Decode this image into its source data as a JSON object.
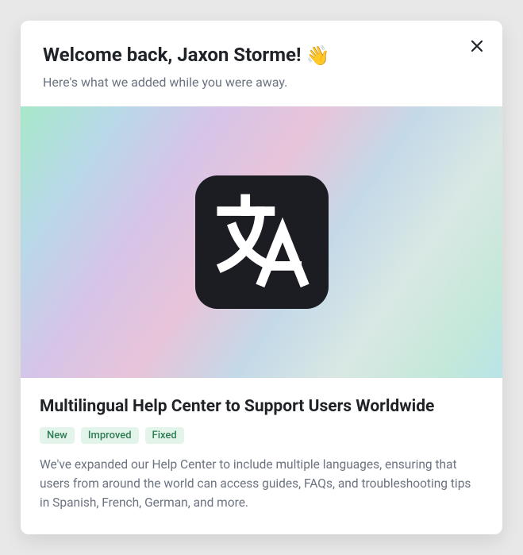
{
  "header": {
    "title": "Welcome back, Jaxon Storme!",
    "wave_emoji": "👋",
    "subtitle": "Here's what we added while you were away."
  },
  "hero": {
    "icon_name": "translate-icon"
  },
  "feature": {
    "title": "Multilingual Help Center to Support Users Worldwide",
    "badges": [
      "New",
      "Improved",
      "Fixed"
    ],
    "description": "We've expanded our Help Center to include multiple languages, ensuring that users from around the world can access guides, FAQs, and troubleshooting tips in Spanish, French, German, and more."
  },
  "colors": {
    "badge_bg": "#e3f4eb",
    "badge_text": "#2f7d52"
  }
}
